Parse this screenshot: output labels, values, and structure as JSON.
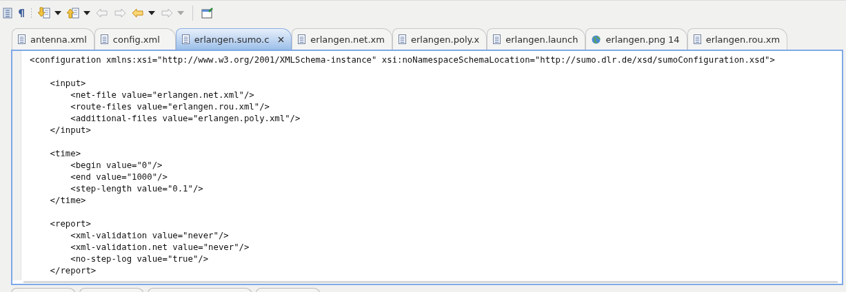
{
  "toolbar": [
    {
      "kind": "outline"
    },
    {
      "kind": "pilcrow"
    },
    {
      "kind": "separator-dots"
    },
    {
      "kind": "next-annotation"
    },
    {
      "kind": "dropdown",
      "disabled": false
    },
    {
      "kind": "prev-annotation"
    },
    {
      "kind": "dropdown",
      "disabled": false
    },
    {
      "kind": "last-edit",
      "disabled": true
    },
    {
      "kind": "next-edit",
      "disabled": true
    },
    {
      "kind": "back",
      "disabled": false
    },
    {
      "kind": "dropdown",
      "disabled": false
    },
    {
      "kind": "forward",
      "disabled": true
    },
    {
      "kind": "dropdown",
      "disabled": true
    },
    {
      "kind": "separator"
    },
    {
      "kind": "new-window"
    }
  ],
  "tabs": [
    {
      "label": "antenna.xml",
      "kind": "document",
      "selected": false
    },
    {
      "label": "config.xml",
      "kind": "document",
      "selected": false
    },
    {
      "label": "erlangen.sumo.c",
      "kind": "document",
      "selected": true
    },
    {
      "label": "erlangen.net.xm",
      "kind": "document",
      "selected": false
    },
    {
      "label": "erlangen.poly.x",
      "kind": "document",
      "selected": false
    },
    {
      "label": "erlangen.launch",
      "kind": "document",
      "selected": false
    },
    {
      "label": "erlangen.png 14",
      "kind": "image",
      "selected": false
    },
    {
      "label": "erlangen.rou.xm",
      "kind": "document",
      "selected": false
    }
  ],
  "editor": {
    "lines": [
      {
        "kind": "code",
        "text": "<configuration xmlns:xsi=\"http://www.w3.org/2001/XMLSchema-instance\" xsi:noNamespaceSchemaLocation=\"http://sumo.dlr.de/xsd/sumoConfiguration.xsd\">"
      },
      {
        "kind": "blank"
      },
      {
        "kind": "code",
        "text": "    <input>"
      },
      {
        "kind": "code",
        "text": "        <net-file value=\"erlangen.net.xml\"/>"
      },
      {
        "kind": "code",
        "text": "        <route-files value=\"erlangen.rou.xml\"/>"
      },
      {
        "kind": "code",
        "text": "        <additional-files value=\"erlangen.poly.xml\"/>"
      },
      {
        "kind": "code",
        "text": "    </input>"
      },
      {
        "kind": "blank"
      },
      {
        "kind": "code",
        "text": "    <time>"
      },
      {
        "kind": "code",
        "text": "        <begin value=\"0\"/>"
      },
      {
        "kind": "code",
        "text": "        <end value=\"1000\"/>"
      },
      {
        "kind": "code",
        "text": "        <step-length value=\"0.1\"/>"
      },
      {
        "kind": "code",
        "text": "    </time>"
      },
      {
        "kind": "blank"
      },
      {
        "kind": "code",
        "text": "    <report>"
      },
      {
        "kind": "code",
        "text": "        <xml-validation value=\"never\"/>"
      },
      {
        "kind": "code",
        "text": "        <xml-validation.net value=\"never\"/>"
      },
      {
        "kind": "code",
        "text": "        <no-step-log value=\"true\"/>"
      },
      {
        "kind": "code",
        "text": "    </report>"
      }
    ]
  }
}
